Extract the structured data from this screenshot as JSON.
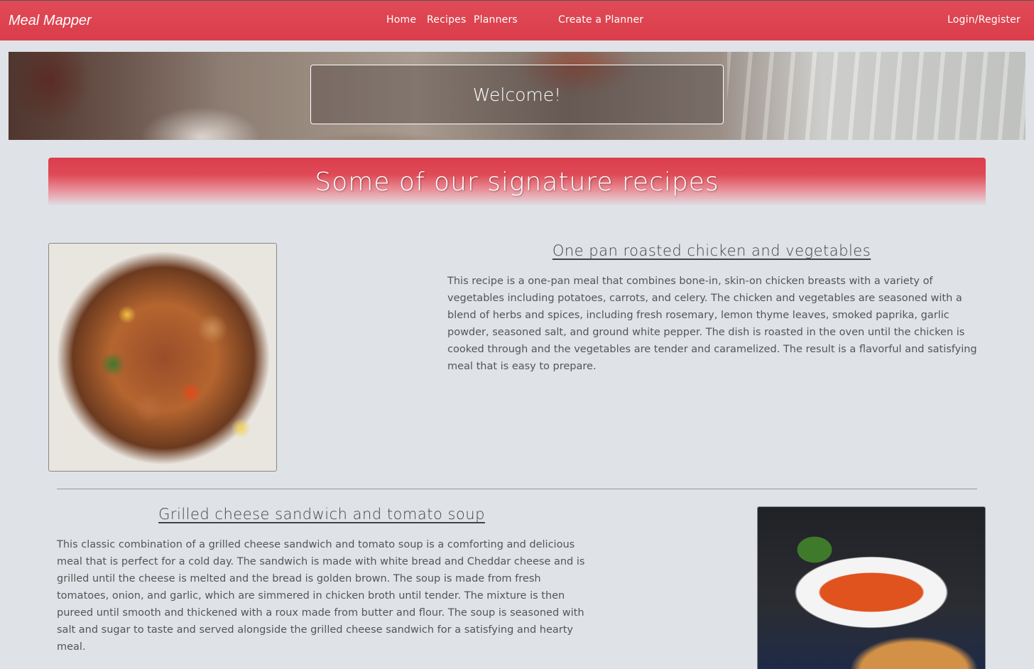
{
  "navbar": {
    "brand": "Meal Mapper",
    "links": [
      "Home",
      "Recipes",
      "Planners",
      "Create a Planner"
    ],
    "login": "Login/Register"
  },
  "hero": {
    "welcome": "Welcome!"
  },
  "section": {
    "title": "Some of our signature recipes"
  },
  "recipes": [
    {
      "title": "One pan roasted chicken and vegetables",
      "description": "This recipe is a one-pan meal that combines bone-in, skin-on chicken breasts with a variety of vegetables including potatoes, carrots, and celery. The chicken and vegetables are seasoned with a blend of herbs and spices, including fresh rosemary, lemon thyme leaves, smoked paprika, garlic powder, seasoned salt, and ground white pepper. The dish is roasted in the oven until the chicken is cooked through and the vegetables are tender and caramelized. The result is a flavorful and satisfying meal that is easy to prepare."
    },
    {
      "title": "Grilled cheese sandwich and tomato soup",
      "description": "This classic combination of a grilled cheese sandwich and tomato soup is a comforting and delicious meal that is perfect for a cold day. The sandwich is made with white bread and Cheddar cheese and is grilled until the cheese is melted and the bread is golden brown. The soup is made from fresh tomatoes, onion, and garlic, which are simmered in chicken broth until tender. The mixture is then pureed until smooth and thickened with a roux made from butter and flour. The soup is seasoned with salt and sugar to taste and served alongside the grilled cheese sandwich for a satisfying and hearty meal."
    }
  ]
}
